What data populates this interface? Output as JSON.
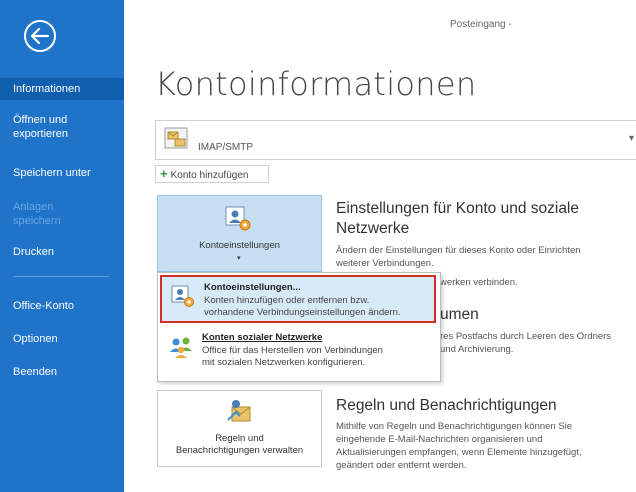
{
  "window": {
    "title": "Posteingang -"
  },
  "sidebar": {
    "items": [
      {
        "label": "Informationen"
      },
      {
        "label": "Öffnen und exportieren"
      },
      {
        "label": "Speichern unter"
      },
      {
        "label": "Anlagen speichern"
      },
      {
        "label": "Drucken"
      },
      {
        "label": "Office-Konto"
      },
      {
        "label": "Optionen"
      },
      {
        "label": "Beenden"
      }
    ],
    "accent": "#1f73c9",
    "active_bg": "#0f5fae"
  },
  "main": {
    "title": "Kontoinformationen",
    "account": {
      "label": "IMAP/SMTP"
    },
    "add_account": {
      "label": "Konto hinzufügen"
    },
    "account_settings": {
      "button_label": "Kontoeinstellungen",
      "title": "Einstellungen für Konto und soziale Netzwerke",
      "desc_line1": "Ändern der Einstellungen für dieses Konto oder Einrichten",
      "desc_line2": "weiterer Verbindungen.",
      "desc_line3": "werken verbinden."
    },
    "cleanup": {
      "title_partial": "umen",
      "desc_line1": "res Postfachs durch Leeren des Ordners",
      "desc_line2": "und Archivierung."
    },
    "rules": {
      "button_line1": "Regeln und",
      "button_line2": "Benachrichtigungen verwalten",
      "title": "Regeln und Benachrichtigungen",
      "desc_line1": "Mithilfe von Regeln und Benachrichtigungen können Sie",
      "desc_line2": "eingehende E-Mail-Nachrichten organisieren und",
      "desc_line3": "Aktualisierungen empfangen, wenn Elemente hinzugefügt,",
      "desc_line4": "geändert oder entfernt werden."
    }
  },
  "dropdown": {
    "items": [
      {
        "title": "Kontoeinstellungen...",
        "desc_line1": "Konten hinzufügen oder entfernen bzw.",
        "desc_line2": "vorhandene Verbindungseinstellungen ändern."
      },
      {
        "title": "Konten sozialer Netzwerke",
        "desc_line1": "Office für das Herstellen von Verbindungen",
        "desc_line2": "mit sozialen Netzwerken konfigurieren."
      }
    ],
    "highlight_color": "#d22b2b"
  }
}
